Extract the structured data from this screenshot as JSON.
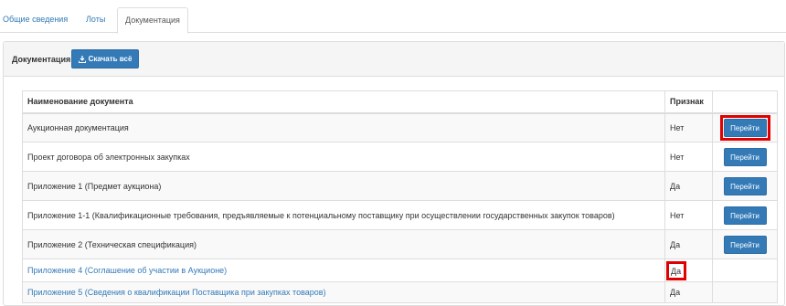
{
  "tabs": [
    {
      "label": "Общие сведения"
    },
    {
      "label": "Лоты"
    },
    {
      "label": "Документация"
    }
  ],
  "panel": {
    "title": "Документация",
    "download_all_label": "Скачать всё"
  },
  "table": {
    "headers": {
      "name": "Наименование документа",
      "flag": "Признак",
      "action": ""
    },
    "rows": [
      {
        "name": "Аукционная документация",
        "flag": "Нет",
        "action": "Перейти"
      },
      {
        "name": "Проект договора об электронных закупках",
        "flag": "Нет",
        "action": "Перейти"
      },
      {
        "name": "Приложение 1 (Предмет аукциона)",
        "flag": "Да",
        "action": "Перейти"
      },
      {
        "name": "Приложение 1-1 (Квалификационные требования, предъявляемые к потенциальному поставщику при осуществлении государственных закупок товаров)",
        "flag": "Нет",
        "action": "Перейти"
      },
      {
        "name": "Приложение 2 (Техническая спецификация)",
        "flag": "Да",
        "action": "Перейти"
      },
      {
        "name": "Приложение 4 (Соглашение об участии в Аукционе)",
        "flag": "Да"
      },
      {
        "name": "Приложение 5 (Сведения о квалификации Поставщика при закупках товаров)",
        "flag": "Да"
      }
    ]
  },
  "colors": {
    "primary": "#337ab7",
    "highlight": "#e00000"
  },
  "icons": {
    "download": "download-icon"
  }
}
